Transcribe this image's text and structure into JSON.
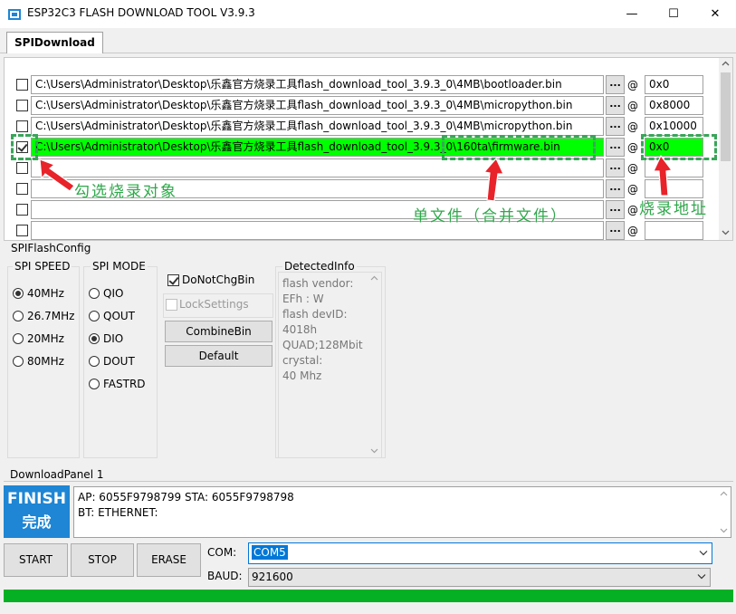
{
  "window": {
    "title": "ESP32C3 FLASH DOWNLOAD TOOL V3.9.3",
    "minimize": "—",
    "maximize": "☐",
    "close": "✕"
  },
  "tab": {
    "label": "SPIDownload"
  },
  "files": [
    {
      "checked": false,
      "path": "C:\\Users\\Administrator\\Desktop\\乐鑫官方烧录工具flash_download_tool_3.9.3_0\\4MB\\bootloader.bin",
      "dots": "...",
      "at": "@",
      "addr": "0x0"
    },
    {
      "checked": false,
      "path": "C:\\Users\\Administrator\\Desktop\\乐鑫官方烧录工具flash_download_tool_3.9.3_0\\4MB\\micropython.bin",
      "dots": "...",
      "at": "@",
      "addr": "0x8000"
    },
    {
      "checked": false,
      "path": "C:\\Users\\Administrator\\Desktop\\乐鑫官方烧录工具flash_download_tool_3.9.3_0\\4MB\\micropython.bin",
      "dots": "...",
      "at": "@",
      "addr": "0x10000"
    },
    {
      "checked": true,
      "path": "C:\\Users\\Administrator\\Desktop\\乐鑫官方烧录工具flash_download_tool_3.9.3_0\\160ta\\firmware.bin",
      "dots": "...",
      "at": "@",
      "addr": "0x0"
    },
    {
      "checked": false,
      "path": "",
      "dots": "...",
      "at": "@",
      "addr": ""
    },
    {
      "checked": false,
      "path": "",
      "dots": "...",
      "at": "@",
      "addr": ""
    },
    {
      "checked": false,
      "path": "",
      "dots": "...",
      "at": "@",
      "addr": ""
    },
    {
      "checked": false,
      "path": "",
      "dots": "...",
      "at": "@",
      "addr": ""
    }
  ],
  "annotations": {
    "select_target": "勾选烧录对象",
    "single_file": "单文件（合并文件）",
    "burn_address": "烧录地址"
  },
  "config": {
    "title": "SPIFlashConfig",
    "speed_title": "SPI SPEED",
    "speeds": [
      "40MHz",
      "26.7MHz",
      "20MHz",
      "80MHz"
    ],
    "speed_selected": "40MHz",
    "mode_title": "SPI MODE",
    "modes": [
      "QIO",
      "QOUT",
      "DIO",
      "DOUT",
      "FASTRD"
    ],
    "mode_selected": "DIO",
    "do_not_chg_bin": "DoNotChgBin",
    "lock_settings": "LockSettings",
    "combine_bin": "CombineBin",
    "default": "Default"
  },
  "detected": {
    "title": "DetectedInfo",
    "lines": [
      "flash vendor:",
      "EFh : W",
      "flash devID:",
      "4018h",
      "QUAD;128Mbit",
      "crystal:",
      "40 Mhz"
    ]
  },
  "download": {
    "panel_title": "DownloadPanel 1",
    "status_en": "FINISH",
    "status_zh": "完成",
    "log_line1": "AP:  6055F9798799  STA:  6055F9798798",
    "log_line2": "BT:    ETHERNET:",
    "start": "START",
    "stop": "STOP",
    "erase": "ERASE",
    "com_label": "COM:",
    "com_value": "COM5",
    "baud_label": "BAUD:",
    "baud_value": "921600",
    "progress": 1.0
  },
  "colors": {
    "selected_row": "#00ff00",
    "finish_bg": "#1e86d4",
    "progress": "#06b025",
    "annotation": "#2ea84a",
    "arrow": "#e8232a"
  }
}
